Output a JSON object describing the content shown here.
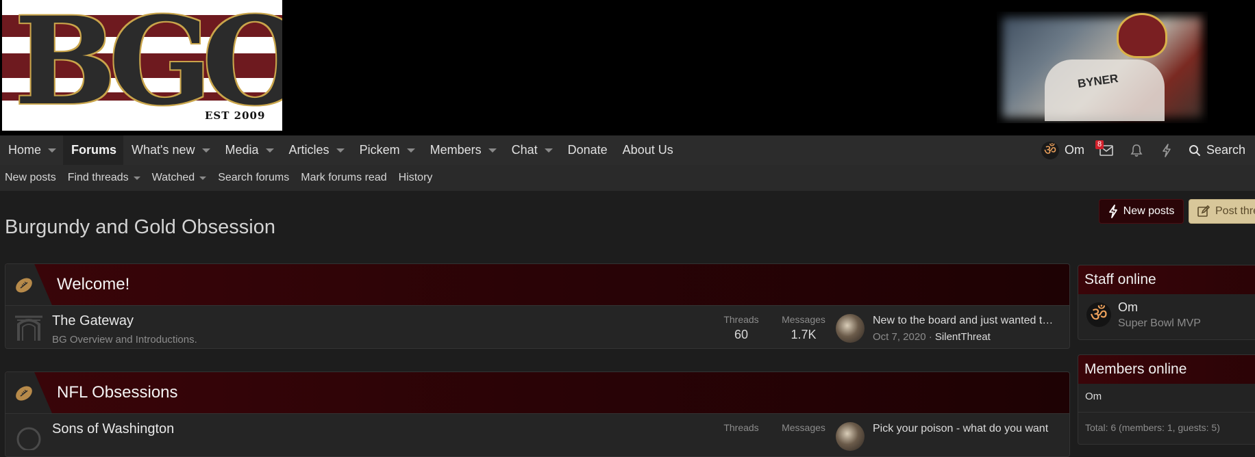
{
  "header": {
    "logo_text": "BGO",
    "logo_est": "EST 2009",
    "photo_jersey_text": "BYNER"
  },
  "nav": {
    "items": [
      {
        "label": "Home"
      },
      {
        "label": "Forums"
      },
      {
        "label": "What's new"
      },
      {
        "label": "Media"
      },
      {
        "label": "Articles"
      },
      {
        "label": "Pickem"
      },
      {
        "label": "Members"
      },
      {
        "label": "Chat"
      },
      {
        "label": "Donate"
      },
      {
        "label": "About Us"
      }
    ],
    "active": "Forums",
    "user": {
      "name": "Om",
      "avatar_glyph": "ॐ"
    },
    "inbox_badge": "8",
    "search_label": "Search"
  },
  "subnav": {
    "items": [
      {
        "label": "New posts"
      },
      {
        "label": "Find threads"
      },
      {
        "label": "Watched"
      },
      {
        "label": "Search forums"
      },
      {
        "label": "Mark forums read"
      },
      {
        "label": "History"
      }
    ]
  },
  "page": {
    "title": "Burgundy and Gold Obsession",
    "new_posts_button": "New posts",
    "post_thread_button": "Post thread"
  },
  "categories": [
    {
      "title": "Welcome!",
      "forums": [
        {
          "title": "The Gateway",
          "description": "BG Overview and Introductions.",
          "threads_label": "Threads",
          "threads": "60",
          "messages_label": "Messages",
          "messages": "1.7K",
          "last_post_title": "New to the board and just wanted to say hello",
          "last_post_date": "Oct 7, 2020",
          "last_post_sep": " · ",
          "last_post_user": "SilentThreat"
        }
      ]
    },
    {
      "title": "NFL Obsessions",
      "forums": [
        {
          "title": "Sons of Washington",
          "threads_label": "Threads",
          "messages_label": "Messages",
          "last_post_title": "Pick your poison - what do you want"
        }
      ]
    }
  ],
  "sidebar": {
    "staff_online": {
      "title": "Staff online",
      "members": [
        {
          "name": "Om",
          "role": "Super Bowl MVP",
          "avatar_glyph": "ॐ"
        }
      ]
    },
    "members_online": {
      "title": "Members online",
      "names": "Om",
      "total": "Total: 6 (members: 1, guests: 5)"
    }
  },
  "colors": {
    "burgundy": "#2a0306",
    "gold_button": "#d8c79a",
    "badge_red": "#d1202b",
    "background": "#1d1d1d"
  }
}
